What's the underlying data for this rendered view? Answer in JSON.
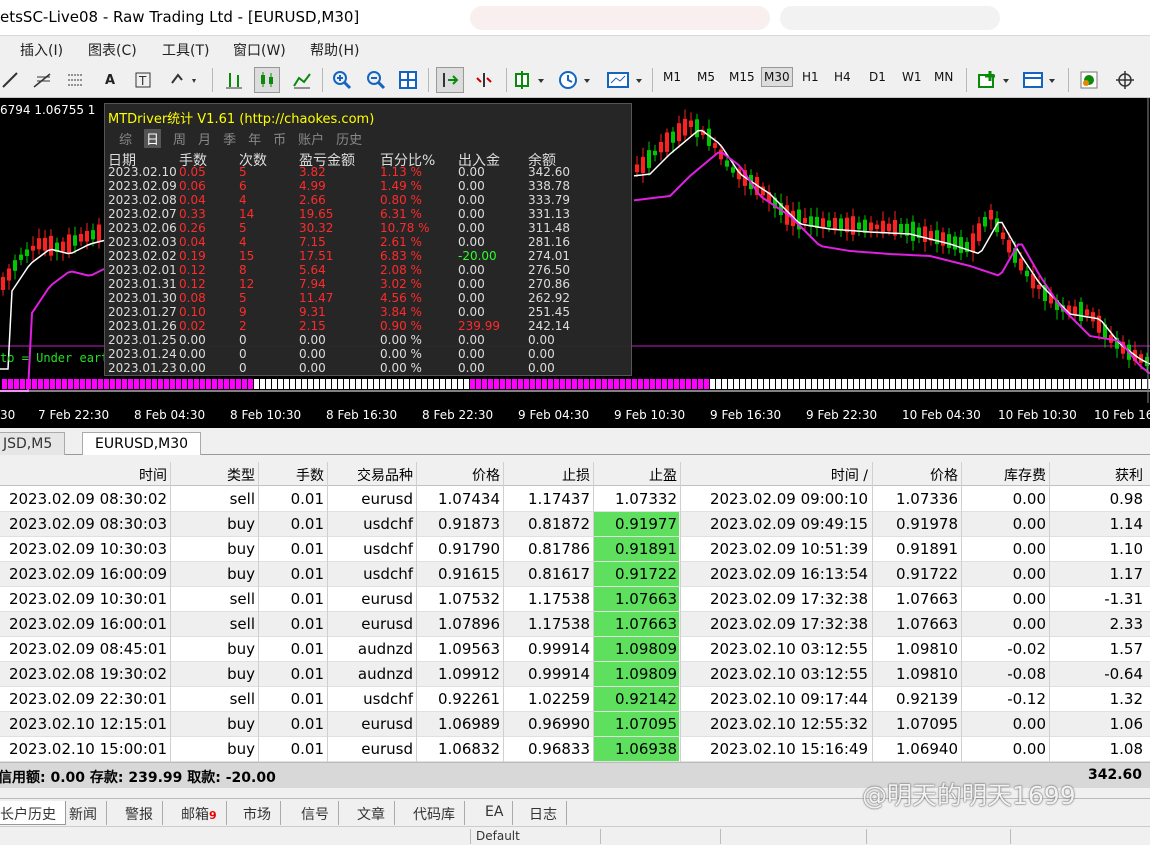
{
  "window": {
    "title": "etsSC-Live08 - Raw Trading Ltd - [EURUSD,M30]"
  },
  "menu": [
    "插入(I)",
    "图表(C)",
    "工具(T)",
    "窗口(W)",
    "帮助(H)"
  ],
  "toolbar": {
    "timeframes": [
      "M1",
      "M5",
      "M15",
      "M30",
      "H1",
      "H4",
      "D1",
      "W1",
      "MN"
    ],
    "selected_timeframe": "M30",
    "icons": [
      "line-tool-icon",
      "fibonacci-icon",
      "channel-icon",
      "text-icon",
      "label-icon",
      "arrows-icon",
      "bar-chart-icon",
      "candle-chart-icon",
      "line-chart-icon",
      "zoom-in-icon",
      "zoom-out-icon",
      "tile-icon",
      "autoscroll-icon",
      "chart-shift-icon",
      "indicators-icon",
      "periods-icon",
      "templates-icon",
      "new-order-icon",
      "profiles-icon",
      "experts-icon",
      "crosshair-icon"
    ]
  },
  "chart": {
    "price_labels": "6794 1.06755 1",
    "indicator_text": "to = Under eart",
    "time_labels": [
      "30",
      "7 Feb 22:30",
      "8 Feb 04:30",
      "8 Feb 10:30",
      "8 Feb 16:30",
      "8 Feb 22:30",
      "9 Feb 04:30",
      "9 Feb 10:30",
      "9 Feb 16:30",
      "9 Feb 22:30",
      "10 Feb 04:30",
      "10 Feb 10:30",
      "10 Feb 16"
    ],
    "colors": {
      "bull": "#00c800",
      "bear": "#ff2020",
      "ma_fast": "#ffffff",
      "ma_slow": "#e020e0",
      "bg": "#000000"
    }
  },
  "stats_panel": {
    "title": "MTDriver统计 V1.61 (http://chaokes.com)",
    "tabs": [
      "综",
      "日",
      "周",
      "月",
      "季",
      "年",
      "币",
      "账户",
      "历史"
    ],
    "active_tab": "日",
    "headers": [
      "日期",
      "手数",
      "次数",
      "盈亏金额",
      "百分比%",
      "出入金",
      "余额"
    ],
    "rows": [
      [
        "2023.02.10",
        "0.05",
        "5",
        "3.82",
        "1.13 %",
        "0.00",
        "342.60"
      ],
      [
        "2023.02.09",
        "0.06",
        "6",
        "4.99",
        "1.49 %",
        "0.00",
        "338.78"
      ],
      [
        "2023.02.08",
        "0.04",
        "4",
        "2.66",
        "0.80 %",
        "0.00",
        "333.79"
      ],
      [
        "2023.02.07",
        "0.33",
        "14",
        "19.65",
        "6.31 %",
        "0.00",
        "331.13"
      ],
      [
        "2023.02.06",
        "0.26",
        "5",
        "30.32",
        "10.78 %",
        "0.00",
        "311.48"
      ],
      [
        "2023.02.03",
        "0.04",
        "4",
        "7.15",
        "2.61 %",
        "0.00",
        "281.16"
      ],
      [
        "2023.02.02",
        "0.19",
        "15",
        "17.51",
        "6.83 %",
        "-20.00",
        "274.01"
      ],
      [
        "2023.02.01",
        "0.12",
        "8",
        "5.64",
        "2.08 %",
        "0.00",
        "276.50"
      ],
      [
        "2023.01.31",
        "0.12",
        "12",
        "7.94",
        "3.02 %",
        "0.00",
        "270.86"
      ],
      [
        "2023.01.30",
        "0.08",
        "5",
        "11.47",
        "4.56 %",
        "0.00",
        "262.92"
      ],
      [
        "2023.01.27",
        "0.10",
        "9",
        "9.31",
        "3.84 %",
        "0.00",
        "251.45"
      ],
      [
        "2023.01.26",
        "0.02",
        "2",
        "2.15",
        "0.90 %",
        "239.99",
        "242.14"
      ],
      [
        "2023.01.25",
        "0.00",
        "0",
        "0.00",
        "0.00 %",
        "0.00",
        "0.00"
      ],
      [
        "2023.01.24",
        "0.00",
        "0",
        "0.00",
        "0.00 %",
        "0.00",
        "0.00"
      ],
      [
        "2023.01.23",
        "0.00",
        "0",
        "0.00",
        "0.00 %",
        "0.00",
        "0.00"
      ]
    ]
  },
  "chart_tabs": [
    "JSD,M5",
    "EURUSD,M30"
  ],
  "active_chart_tab": "EURUSD,M30",
  "history": {
    "headers": [
      "时间",
      "类型",
      "手数",
      "交易品种",
      "价格",
      "止损",
      "止盈",
      "时间 /",
      "价格",
      "库存费",
      "获利"
    ],
    "rows": [
      [
        "2023.02.09 08:30:02",
        "sell",
        "0.01",
        "eurusd",
        "1.07434",
        "1.17437",
        "1.07332",
        "2023.02.09 09:00:10",
        "1.07336",
        "0.00",
        "0.98"
      ],
      [
        "2023.02.09 08:30:03",
        "buy",
        "0.01",
        "usdchf",
        "0.91873",
        "0.81872",
        "0.91977",
        "2023.02.09 09:49:15",
        "0.91978",
        "0.00",
        "1.14"
      ],
      [
        "2023.02.09 10:30:03",
        "buy",
        "0.01",
        "usdchf",
        "0.91790",
        "0.81786",
        "0.91891",
        "2023.02.09 10:51:39",
        "0.91891",
        "0.00",
        "1.10"
      ],
      [
        "2023.02.09 16:00:09",
        "buy",
        "0.01",
        "usdchf",
        "0.91615",
        "0.81617",
        "0.91722",
        "2023.02.09 16:13:54",
        "0.91722",
        "0.00",
        "1.17"
      ],
      [
        "2023.02.09 10:30:01",
        "sell",
        "0.01",
        "eurusd",
        "1.07532",
        "1.17538",
        "1.07663",
        "2023.02.09 17:32:38",
        "1.07663",
        "0.00",
        "-1.31"
      ],
      [
        "2023.02.09 16:00:01",
        "sell",
        "0.01",
        "eurusd",
        "1.07896",
        "1.17538",
        "1.07663",
        "2023.02.09 17:32:38",
        "1.07663",
        "0.00",
        "2.33"
      ],
      [
        "2023.02.09 08:45:01",
        "buy",
        "0.01",
        "audnzd",
        "1.09563",
        "0.99914",
        "1.09809",
        "2023.02.10 03:12:55",
        "1.09810",
        "-0.02",
        "1.57"
      ],
      [
        "2023.02.08 19:30:02",
        "buy",
        "0.01",
        "audnzd",
        "1.09912",
        "0.99914",
        "1.09809",
        "2023.02.10 03:12:55",
        "1.09810",
        "-0.08",
        "-0.64"
      ],
      [
        "2023.02.09 22:30:01",
        "sell",
        "0.01",
        "usdchf",
        "0.92261",
        "1.02259",
        "0.92142",
        "2023.02.10 09:17:44",
        "0.92139",
        "-0.12",
        "1.32"
      ],
      [
        "2023.02.10 12:15:01",
        "buy",
        "0.01",
        "eurusd",
        "1.06989",
        "0.96990",
        "1.07095",
        "2023.02.10 12:55:32",
        "1.07095",
        "0.00",
        "1.06"
      ],
      [
        "2023.02.10 15:00:01",
        "buy",
        "0.01",
        "eurusd",
        "1.06832",
        "0.96833",
        "1.06938",
        "2023.02.10 15:16:49",
        "1.06940",
        "0.00",
        "1.08"
      ]
    ],
    "tp_highlight_rows": [
      1,
      2,
      3,
      4,
      5,
      6,
      7,
      8,
      9,
      10
    ]
  },
  "summary": {
    "left": "信用额: 0.00  存款: 239.99  取款: -20.00",
    "total": "342.60"
  },
  "bottom_tabs": [
    {
      "label": "长户历史",
      "active": true
    },
    {
      "label": "新闻"
    },
    {
      "label": "警报"
    },
    {
      "label": "邮箱",
      "badge": "9"
    },
    {
      "label": "市场"
    },
    {
      "label": "信号"
    },
    {
      "label": "文章"
    },
    {
      "label": "代码库"
    },
    {
      "label": "EA"
    },
    {
      "label": "日志"
    }
  ],
  "status": {
    "profile": "Default"
  },
  "watermark": "@明天的明天1699"
}
